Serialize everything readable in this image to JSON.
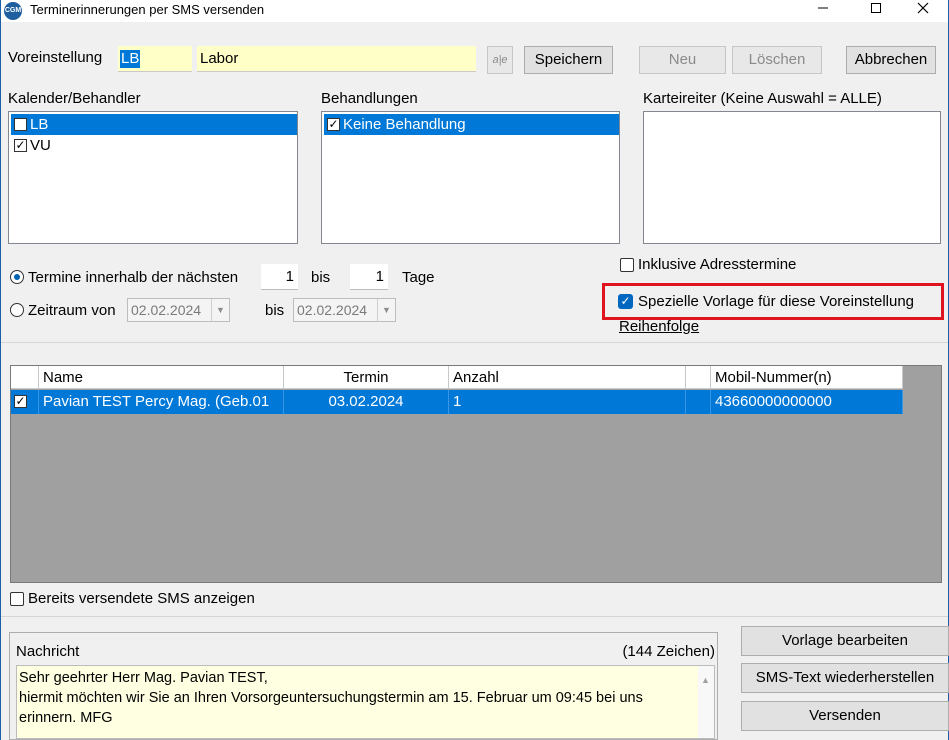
{
  "window": {
    "icon_text": "CGM",
    "title": "Terminerinnerungen per SMS versenden",
    "minimize_icon": "minimize-icon",
    "maximize_icon": "maximize-icon",
    "close_icon": "close-icon"
  },
  "preset": {
    "label": "Voreinstellung",
    "code": "LB",
    "name": "Labor",
    "spell_icon": "spellcheck-icon",
    "spell_glyph": "a|e",
    "save": "Speichern",
    "new": "Neu",
    "delete": "Löschen",
    "cancel": "Abbrechen"
  },
  "calendar": {
    "label": "Kalender/Behandler",
    "items": [
      {
        "text": "LB",
        "checked": false,
        "selected": true
      },
      {
        "text": "VU",
        "checked": true,
        "selected": false
      }
    ]
  },
  "treatments": {
    "label": "Behandlungen",
    "items": [
      {
        "text": "Keine Behandlung",
        "checked": true,
        "selected": true
      }
    ]
  },
  "tabs_filter": {
    "label": "Karteireiter (Keine Auswahl = ALLE)"
  },
  "period": {
    "radio1_label": "Termine innerhalb der nächsten",
    "from_days": "1",
    "bis1": "bis",
    "to_days": "1",
    "days_label": "Tage",
    "radio2_label": "Zeitraum von",
    "date_from": "02.02.2024",
    "bis2": "bis",
    "date_to": "02.02.2024",
    "selected": "radio1"
  },
  "options": {
    "include_address": "Inklusive Adresstermine",
    "include_address_checked": false,
    "special_template": "Spezielle Vorlage für diese Voreinstellung",
    "special_template_checked": true,
    "order_link": "Reihenfolge",
    "highlight_color": "#e0141e"
  },
  "grid": {
    "columns": [
      "Name",
      "Termin",
      "Anzahl",
      "",
      "Mobil-Nummer(n)"
    ],
    "rows": [
      {
        "checked": true,
        "name": "Pavian TEST Percy Mag. (Geb.01",
        "termin": "03.02.2024",
        "anzahl": "1",
        "extra": "",
        "mobil": "43660000000000"
      }
    ]
  },
  "show_sent": {
    "label": "Bereits versendete SMS anzeigen",
    "checked": false
  },
  "message": {
    "label": "Nachricht",
    "count": "(144 Zeichen)",
    "lines": [
      "Sehr geehrter Herr Mag. Pavian TEST,",
      "hiermit möchten wir Sie an Ihren Vorsorgeuntersuchungstermin am 15. Februar um 09:45 bei uns",
      "erinnern. MFG"
    ]
  },
  "actions": {
    "edit_template": "Vorlage bearbeiten",
    "restore_text": "SMS-Text wiederherstellen",
    "send": "Versenden"
  },
  "colors": {
    "selection": "#0078d7",
    "message_bg": "#ffffe1",
    "preset_bg": "#ffffc8",
    "grid_bg": "#a0a0a0"
  }
}
